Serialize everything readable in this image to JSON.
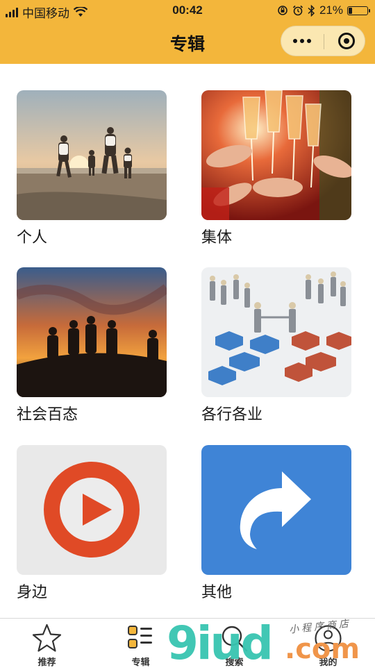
{
  "status_bar": {
    "carrier": "中国移动",
    "time": "00:42",
    "battery_percent": "21%",
    "battery_level": 0.21
  },
  "nav": {
    "title": "专辑",
    "more_icon": "more-dots-icon",
    "close_icon": "target-circle-icon"
  },
  "albums": [
    {
      "label": "个人",
      "image": "family-beach-sunset"
    },
    {
      "label": "集体",
      "image": "champagne-toast"
    },
    {
      "label": "社会百态",
      "image": "silhouettes-sunset"
    },
    {
      "label": "各行各业",
      "image": "business-figures-hexagons"
    },
    {
      "label": "身边",
      "image": "play-circle-icon"
    },
    {
      "label": "其他",
      "image": "share-arrow-icon"
    }
  ],
  "tabs": [
    {
      "label": "推荐",
      "icon": "star-icon",
      "active": false
    },
    {
      "label": "专辑",
      "icon": "album-list-icon",
      "active": true
    },
    {
      "label": "搜索",
      "icon": "search-icon",
      "active": false
    },
    {
      "label": "我的",
      "icon": "user-icon",
      "active": false
    }
  ],
  "watermark": {
    "main": "9iud",
    "domain": ".com",
    "tagline": "小程序商店"
  },
  "colors": {
    "accent": "#f3b63b",
    "capsule": "#fbe7b1",
    "play_red": "#e04a26",
    "share_blue": "#3f84d6"
  }
}
